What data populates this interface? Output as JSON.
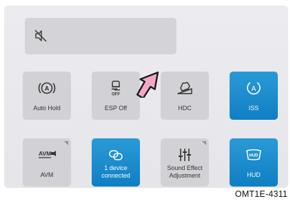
{
  "volume": {
    "icon": "speaker-muted-icon"
  },
  "tiles": [
    {
      "label": "Auto Hold",
      "icon": "auto-hold-icon",
      "active": false
    },
    {
      "label": "ESP Off",
      "icon": "esp-off-icon",
      "active": false
    },
    {
      "label": "HDC",
      "icon": "hill-descent-icon",
      "active": false
    },
    {
      "label": "ISS",
      "icon": "idle-stop-start-icon",
      "active": true
    },
    {
      "label": "AVM",
      "icon": "avm-camera-icon",
      "active": false
    },
    {
      "label_line1": "1 device",
      "label_line2": "connected",
      "icon": "link-icon",
      "active": true
    },
    {
      "label_line1": "Sound Effect",
      "label_line2": "Adjustment",
      "icon": "equalizer-icon",
      "active": false
    },
    {
      "label": "HUD",
      "icon": "hud-icon",
      "active": true
    }
  ],
  "colors": {
    "active_tile": "#1a8ccf",
    "inactive_tile": "#d2d2d6",
    "pointer_arrow": "#f4a6c8"
  },
  "caption": "OMT1E-4311",
  "pointer": {
    "icon": "pointer-arrow-icon",
    "target": "ESP Off"
  }
}
